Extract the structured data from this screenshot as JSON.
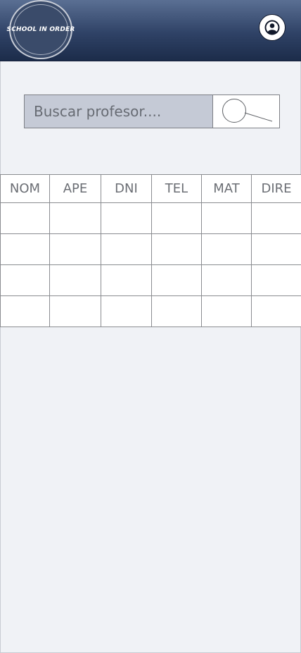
{
  "header": {
    "logo_text": "SCHOOL IN ORDER",
    "profile_icon": "user-circle-icon",
    "background": "#2f4266"
  },
  "search": {
    "placeholder": "Buscar profesor....",
    "value": "",
    "icon": "magnifier-icon"
  },
  "table": {
    "columns": [
      "NOM",
      "APE",
      "DNI",
      "TEL",
      "MAT",
      "DIRE"
    ],
    "rows": [
      [
        "",
        "",
        "",
        "",
        "",
        ""
      ],
      [
        "",
        "",
        "",
        "",
        "",
        ""
      ],
      [
        "",
        "",
        "",
        "",
        "",
        ""
      ],
      [
        "",
        "",
        "",
        "",
        "",
        ""
      ]
    ]
  }
}
